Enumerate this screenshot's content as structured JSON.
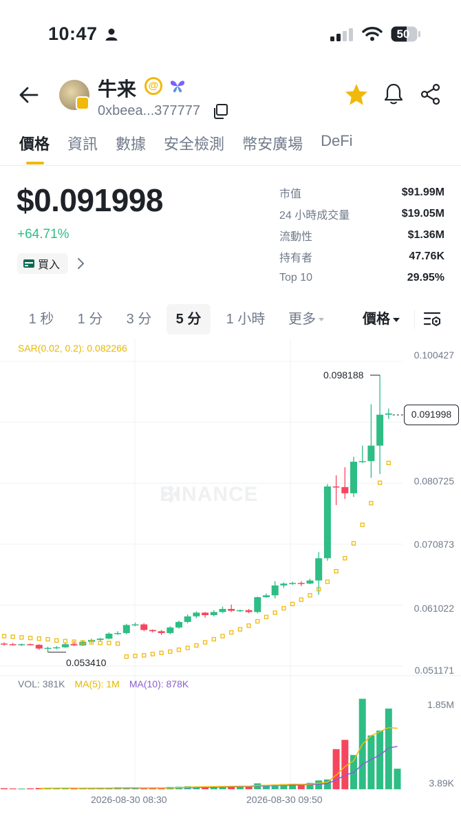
{
  "status_bar": {
    "time": "10:47",
    "battery": "50"
  },
  "header": {
    "token_name": "牛来",
    "address": "0xbeea...377777"
  },
  "tabs": [
    {
      "label": "價格",
      "active": true
    },
    {
      "label": "資訊",
      "active": false
    },
    {
      "label": "數據",
      "active": false
    },
    {
      "label": "安全檢測",
      "active": false
    },
    {
      "label": "幣安廣場",
      "active": false
    },
    {
      "label": "DeFi",
      "active": false
    }
  ],
  "price_block": {
    "price": "$0.091998",
    "change": "+64.71%",
    "buy_label": "買入"
  },
  "stats": [
    {
      "label": "市值",
      "value": "$91.99M"
    },
    {
      "label": "24 小時成交量",
      "value": "$19.05M"
    },
    {
      "label": "流動性",
      "value": "$1.36M"
    },
    {
      "label": "持有者",
      "value": "47.76K"
    },
    {
      "label": "Top 10",
      "value": "29.95%"
    }
  ],
  "timeframes": {
    "options": [
      "1 秒",
      "1 分",
      "3 分",
      "5 分",
      "1 小時",
      "更多"
    ],
    "active": "5 分",
    "price_selector": "價格"
  },
  "chart": {
    "sar_label": "SAR(0.02, 0.2): 0.082266",
    "watermark": "BINANCE",
    "price_axis": [
      "0.100427",
      "0.080725",
      "0.070873",
      "0.061022",
      "0.051171"
    ],
    "current_price": "0.091998",
    "high_label": "0.098188",
    "low_label": "0.053410",
    "vol_legend": {
      "vol": "VOL: 381K",
      "ma5": "MA(5): 1M",
      "ma10": "MA(10): 878K"
    },
    "volume_axis": [
      "1.85M",
      "3.89K"
    ],
    "time_axis": [
      "2026-08-30 08:30",
      "2026-08-30 09:50"
    ],
    "colors": {
      "up": "#2ebd85",
      "down": "#f6465d",
      "sar": "#f0b90b",
      "ma5": "#f0b90b",
      "ma10": "#8b5cd6"
    }
  },
  "chart_data": {
    "type": "candlestick",
    "title": "",
    "ylim": [
      0.0505,
      0.101
    ],
    "candles": [
      {
        "o": 0.0548,
        "h": 0.055,
        "l": 0.0545,
        "c": 0.0547
      },
      {
        "o": 0.0547,
        "h": 0.0549,
        "l": 0.0545,
        "c": 0.0546
      },
      {
        "o": 0.0546,
        "h": 0.0548,
        "l": 0.0544,
        "c": 0.0547
      },
      {
        "o": 0.0547,
        "h": 0.0548,
        "l": 0.0545,
        "c": 0.0546
      },
      {
        "o": 0.0546,
        "h": 0.0547,
        "l": 0.0538,
        "c": 0.054
      },
      {
        "o": 0.054,
        "h": 0.0543,
        "l": 0.0534,
        "c": 0.0541
      },
      {
        "o": 0.0541,
        "h": 0.0544,
        "l": 0.0539,
        "c": 0.0542
      },
      {
        "o": 0.0542,
        "h": 0.0549,
        "l": 0.0541,
        "c": 0.0547
      },
      {
        "o": 0.0547,
        "h": 0.0552,
        "l": 0.0544,
        "c": 0.0545
      },
      {
        "o": 0.0545,
        "h": 0.0553,
        "l": 0.0544,
        "c": 0.0551
      },
      {
        "o": 0.0551,
        "h": 0.0556,
        "l": 0.0549,
        "c": 0.0554
      },
      {
        "o": 0.0554,
        "h": 0.0557,
        "l": 0.0552,
        "c": 0.0556
      },
      {
        "o": 0.0556,
        "h": 0.0566,
        "l": 0.0555,
        "c": 0.0564
      },
      {
        "o": 0.0564,
        "h": 0.0568,
        "l": 0.0562,
        "c": 0.0565
      },
      {
        "o": 0.0565,
        "h": 0.058,
        "l": 0.0563,
        "c": 0.0578
      },
      {
        "o": 0.0578,
        "h": 0.0582,
        "l": 0.0576,
        "c": 0.0579
      },
      {
        "o": 0.0579,
        "h": 0.0581,
        "l": 0.0568,
        "c": 0.057
      },
      {
        "o": 0.057,
        "h": 0.0571,
        "l": 0.0566,
        "c": 0.0568
      },
      {
        "o": 0.0568,
        "h": 0.057,
        "l": 0.0562,
        "c": 0.0565
      },
      {
        "o": 0.0565,
        "h": 0.0576,
        "l": 0.0563,
        "c": 0.0574
      },
      {
        "o": 0.0574,
        "h": 0.0585,
        "l": 0.0572,
        "c": 0.0583
      },
      {
        "o": 0.0583,
        "h": 0.0595,
        "l": 0.0581,
        "c": 0.0592
      },
      {
        "o": 0.0592,
        "h": 0.06,
        "l": 0.0589,
        "c": 0.0598
      },
      {
        "o": 0.0598,
        "h": 0.0599,
        "l": 0.059,
        "c": 0.0594
      },
      {
        "o": 0.0594,
        "h": 0.0602,
        "l": 0.0592,
        "c": 0.0599
      },
      {
        "o": 0.0599,
        "h": 0.0608,
        "l": 0.0597,
        "c": 0.0604
      },
      {
        "o": 0.0604,
        "h": 0.0611,
        "l": 0.0599,
        "c": 0.0601
      },
      {
        "o": 0.0601,
        "h": 0.0603,
        "l": 0.0599,
        "c": 0.0602
      },
      {
        "o": 0.0602,
        "h": 0.0604,
        "l": 0.0597,
        "c": 0.0599
      },
      {
        "o": 0.0599,
        "h": 0.0624,
        "l": 0.0597,
        "c": 0.0623
      },
      {
        "o": 0.0623,
        "h": 0.0629,
        "l": 0.0622,
        "c": 0.0626
      },
      {
        "o": 0.0626,
        "h": 0.0649,
        "l": 0.0621,
        "c": 0.0642
      },
      {
        "o": 0.0642,
        "h": 0.0647,
        "l": 0.0638,
        "c": 0.0645
      },
      {
        "o": 0.0645,
        "h": 0.0648,
        "l": 0.0643,
        "c": 0.0646
      },
      {
        "o": 0.0646,
        "h": 0.0649,
        "l": 0.0641,
        "c": 0.0645
      },
      {
        "o": 0.0645,
        "h": 0.0653,
        "l": 0.0644,
        "c": 0.065
      },
      {
        "o": 0.065,
        "h": 0.0696,
        "l": 0.0627,
        "c": 0.0686
      },
      {
        "o": 0.0686,
        "h": 0.0806,
        "l": 0.0682,
        "c": 0.0802
      },
      {
        "o": 0.0802,
        "h": 0.082,
        "l": 0.0772,
        "c": 0.0801
      },
      {
        "o": 0.0801,
        "h": 0.0833,
        "l": 0.0782,
        "c": 0.0791
      },
      {
        "o": 0.0791,
        "h": 0.085,
        "l": 0.0785,
        "c": 0.0842
      },
      {
        "o": 0.0842,
        "h": 0.0868,
        "l": 0.084,
        "c": 0.0843
      },
      {
        "o": 0.0843,
        "h": 0.0935,
        "l": 0.0816,
        "c": 0.0868
      },
      {
        "o": 0.0868,
        "h": 0.0982,
        "l": 0.0822,
        "c": 0.0918
      },
      {
        "o": 0.0918,
        "h": 0.0928,
        "l": 0.0911,
        "c": 0.092
      }
    ],
    "sar": [
      0.056,
      0.0559,
      0.0558,
      0.0557,
      0.0556,
      0.0555,
      0.0553,
      0.0552,
      0.0551,
      0.055,
      0.055,
      0.0549,
      0.0549,
      0.0548,
      0.0527,
      0.0528,
      0.0529,
      0.0531,
      0.0533,
      0.0535,
      0.0538,
      0.0541,
      0.0545,
      0.055,
      0.0555,
      0.056,
      0.0566,
      0.0571,
      0.0577,
      0.0584,
      0.0591,
      0.0598,
      0.0605,
      0.0612,
      0.0619,
      0.0626,
      0.0636,
      0.0648,
      0.0665,
      0.0686,
      0.071,
      0.074,
      0.0775,
      0.0808,
      0.084
    ],
    "volume": [
      20,
      15,
      12,
      18,
      25,
      30,
      22,
      14,
      20,
      18,
      25,
      30,
      22,
      40,
      35,
      20,
      18,
      26,
      28,
      45,
      50,
      60,
      52,
      48,
      56,
      64,
      60,
      70,
      65,
      120,
      88,
      96,
      105,
      110,
      100,
      130,
      180,
      200,
      820,
      1010,
      700,
      1850,
      1100,
      1200,
      1650,
      420
    ],
    "volume_ylim": [
      0,
      1900
    ],
    "ma5": [
      null,
      null,
      null,
      null,
      18,
      20,
      22,
      22,
      22,
      21,
      21,
      23,
      25,
      27,
      30,
      30,
      27,
      27,
      25,
      27,
      33,
      41,
      47,
      51,
      54,
      56,
      60,
      63,
      63,
      76,
      81,
      86,
      92,
      104,
      100,
      106,
      124,
      143,
      287,
      462,
      582,
      922,
      1096,
      1176,
      1260,
      1248
    ],
    "ma10": [
      null,
      null,
      null,
      null,
      null,
      null,
      null,
      null,
      null,
      20,
      20,
      20,
      21,
      23,
      24,
      25,
      25,
      26,
      27,
      29,
      31,
      34,
      37,
      40,
      43,
      46,
      50,
      54,
      57,
      65,
      70,
      74,
      79,
      84,
      88,
      95,
      103,
      115,
      190,
      285,
      343,
      508,
      609,
      697,
      842,
      876
    ]
  }
}
